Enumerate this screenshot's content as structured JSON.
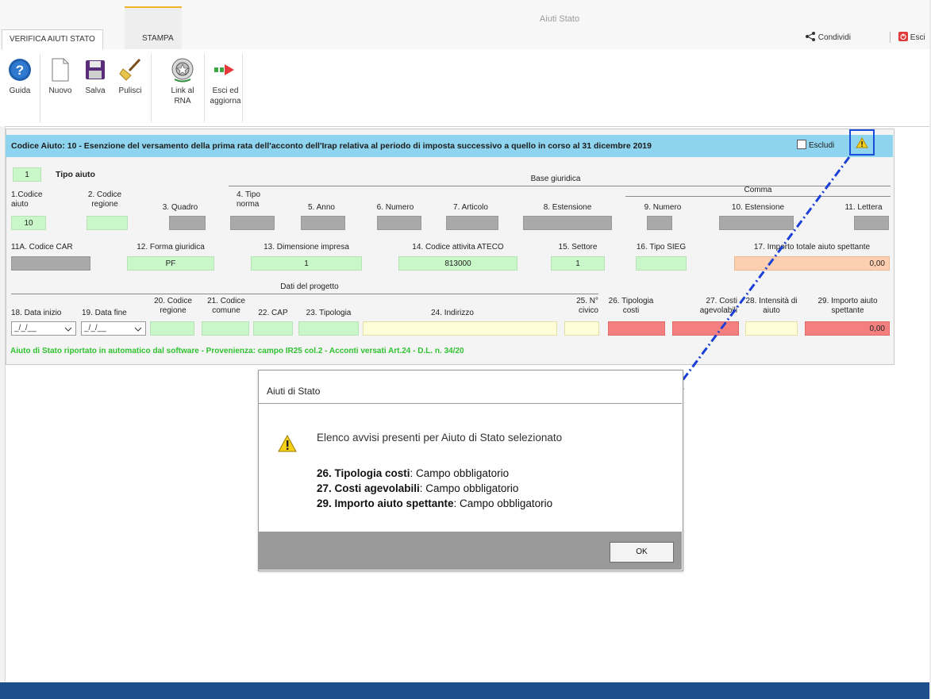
{
  "app": {
    "title": "Aiuti Stato"
  },
  "tabs": [
    {
      "label": "VERIFICA AIUTI STATO"
    },
    {
      "label": "STAMPA"
    }
  ],
  "actions": {
    "share": "Condividi",
    "exit": "Esci"
  },
  "ribbon": [
    {
      "label": "Guida",
      "icon": "help-icon"
    },
    {
      "label": "Nuovo",
      "icon": "new-document-icon"
    },
    {
      "label": "Salva",
      "icon": "save-icon"
    },
    {
      "label": "Pulisci",
      "icon": "broom-icon"
    },
    {
      "label": "Link al RNA",
      "icon": "emblem-icon"
    },
    {
      "label": "Esci ed aggiorna",
      "icon": "exit-arrow-icon"
    }
  ],
  "aid": {
    "header": "Codice Aiuto: 10 - Esenzione del versamento della prima rata dell'acconto dell'Irap relativa al periodo di imposta successivo a quello in corso al 31 dicembre 2019",
    "exclude_label": "Escludi",
    "tipo_aiuto_value": "1",
    "tipo_aiuto_label": "Tipo aiuto",
    "base_giuridica": "Base giuridica",
    "comma": "Comma",
    "dati_progetto": "Dati del progetto",
    "labels": {
      "f1": "1.Codice aiuto",
      "f2": "2. Codice regione",
      "f3": "3. Quadro",
      "f4": "4. Tipo norma",
      "f5": "5. Anno",
      "f6": "6. Numero",
      "f7": "7. Articolo",
      "f8": "8. Estensione",
      "f9": "9. Numero",
      "f10": "10. Estensione",
      "f11": "11. Lettera",
      "f11a": "11A. Codice CAR",
      "f12": "12. Forma giuridica",
      "f13": "13. Dimensione impresa",
      "f14": "14. Codice attivita ATECO",
      "f15": "15. Settore",
      "f16": "16. Tipo SIEG",
      "f17": "17. Importo totale aiuto spettante",
      "f18": "18. Data inizio",
      "f19": "19. Data fine",
      "f20": "20. Codice regione",
      "f21": "21. Codice comune",
      "f22": "22. CAP",
      "f23": "23. Tipologia",
      "f24": "24. Indirizzo",
      "f25": "25. N° civico",
      "f26": "26. Tipologia costi",
      "f27": "27. Costi agevolabili",
      "f28": "28. Intensità di aiuto",
      "f29": "29. Importo aiuto spettante"
    },
    "values": {
      "codice_aiuto": "10",
      "forma_giuridica": "PF",
      "dimensione_impresa": "1",
      "ateco": "813000",
      "settore": "1",
      "importo_totale": "0,00",
      "data_inizio": "_/_/__",
      "data_fine": "_/_/__",
      "importo_spettante": "0,00"
    },
    "footnote": "Aiuto di Stato riportato in automatico dal software - Provenienza: campo IR25 col.2 - Acconti versati Art.24 - D.L. n. 34/20"
  },
  "dialog": {
    "title": "Aiuti di Stato",
    "message": "Elenco avvisi presenti per Aiuto di Stato selezionato",
    "items": [
      {
        "field": "26. Tipologia costi",
        "text": ": Campo obbligatorio"
      },
      {
        "field": "27. Costi agevolabili",
        "text": ": Campo obbligatorio"
      },
      {
        "field": "29. Importo aiuto spettante",
        "text": ": Campo obbligatorio"
      }
    ],
    "ok": "OK"
  },
  "colors": {
    "header": "#8fd4ee",
    "field_green": "#c9f7c9",
    "field_red": "#f47f7f",
    "highlight": "#1a4ddb",
    "footnote": "#30c230"
  }
}
